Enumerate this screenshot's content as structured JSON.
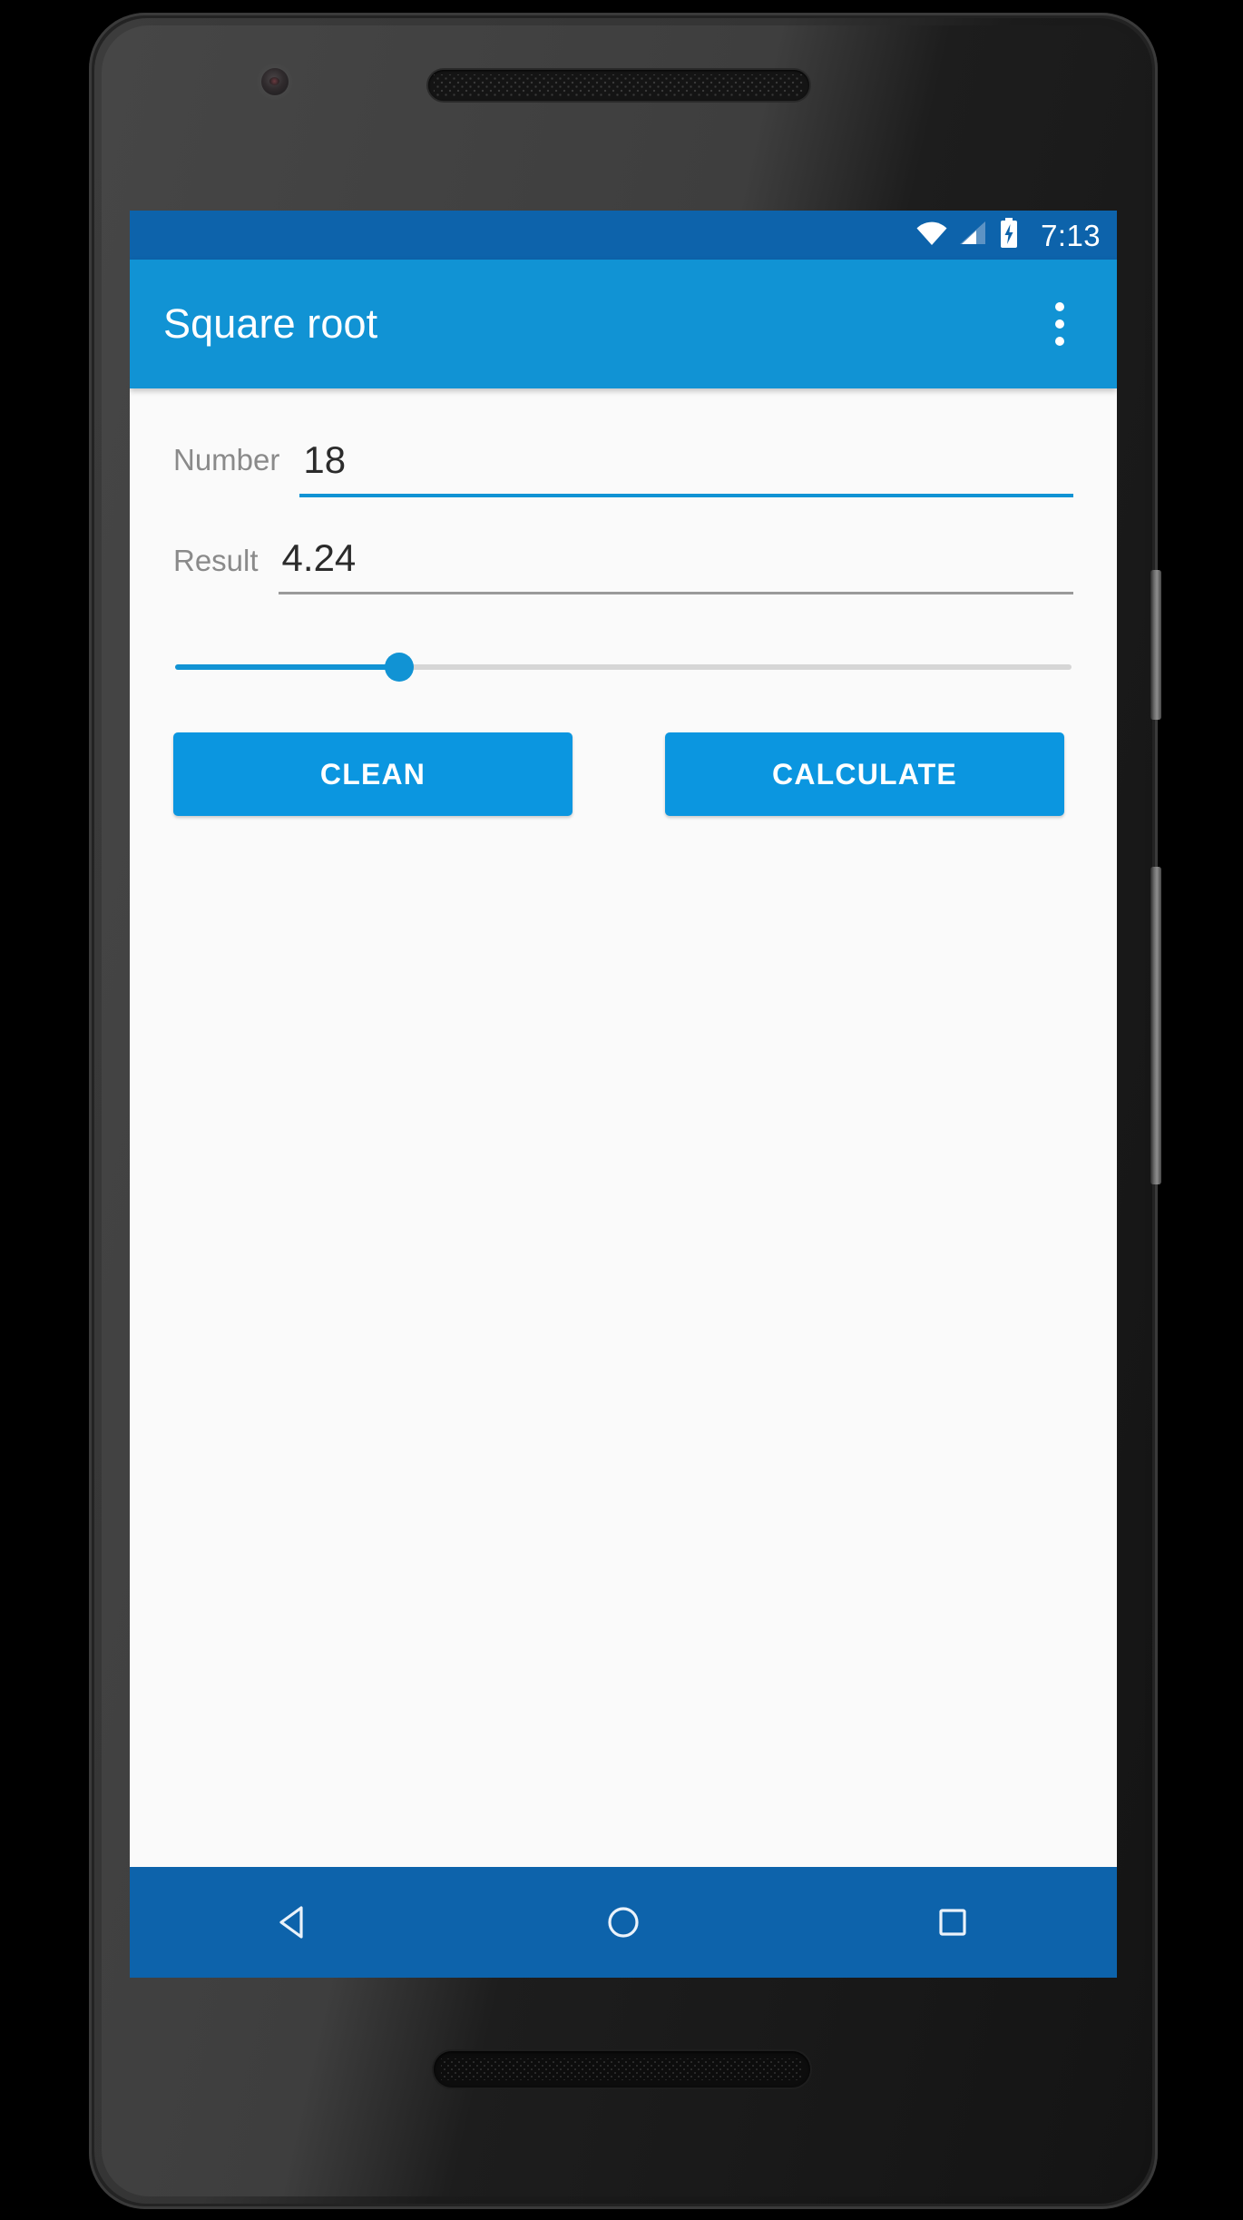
{
  "device": {
    "frame_color": "#232323",
    "camera": "front-camera",
    "earpiece": "earpiece-speaker",
    "bottom_speaker": "bottom-speaker",
    "side_buttons": [
      "power",
      "volume"
    ]
  },
  "status_bar": {
    "background": "#0d63ab",
    "time": "7:13",
    "icons": [
      "wifi-icon",
      "cellular-signal-icon",
      "battery-charging-icon"
    ],
    "wifi_label": "wifi-icon",
    "signal_label": "cellular-signal-icon",
    "battery_label": "battery-charging-icon"
  },
  "app_bar": {
    "background": "#1193d4",
    "title": "Square root",
    "overflow_label": "overflow-menu-icon"
  },
  "content": {
    "background": "#fafafa",
    "number_field": {
      "label": "Number",
      "value": "18",
      "placeholder": "",
      "focused": true,
      "underline_color": "#1193d4"
    },
    "result_field": {
      "label": "Result",
      "value": "4.24",
      "placeholder": "",
      "focused": false,
      "underline_color": "#9a9a9a"
    },
    "slider": {
      "name": "precision-slider",
      "value": 25,
      "min": 0,
      "max": 100,
      "fill_color": "#1193d4",
      "track_color": "#d6d6d6"
    },
    "buttons": {
      "clean_label": "CLEAN",
      "calculate_label": "CALCULATE",
      "color": "#0b96e0"
    }
  },
  "nav_bar": {
    "background": "#0d63ab",
    "back_label": "back-nav-icon",
    "home_label": "home-nav-icon",
    "recents_label": "recents-nav-icon"
  }
}
